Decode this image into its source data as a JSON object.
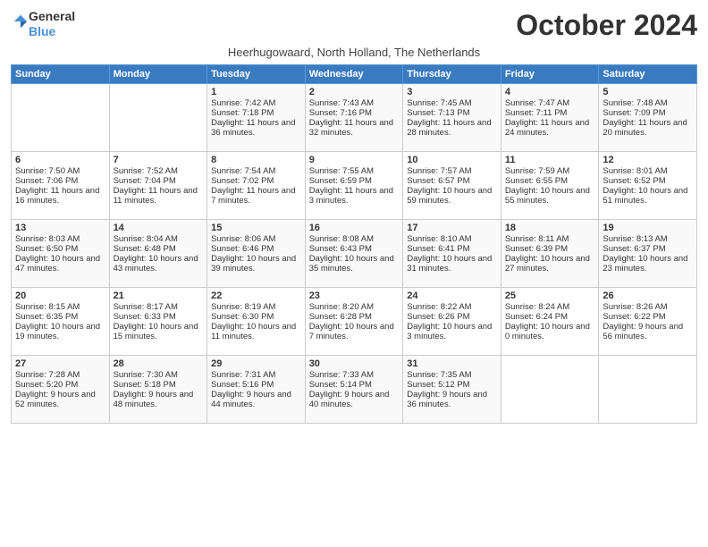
{
  "logo": {
    "line1": "General",
    "line2": "Blue"
  },
  "title": "October 2024",
  "subtitle": "Heerhugowaard, North Holland, The Netherlands",
  "headers": [
    "Sunday",
    "Monday",
    "Tuesday",
    "Wednesday",
    "Thursday",
    "Friday",
    "Saturday"
  ],
  "weeks": [
    [
      {
        "day": "",
        "sunrise": "",
        "sunset": "",
        "daylight": ""
      },
      {
        "day": "",
        "sunrise": "",
        "sunset": "",
        "daylight": ""
      },
      {
        "day": "1",
        "sunrise": "Sunrise: 7:42 AM",
        "sunset": "Sunset: 7:18 PM",
        "daylight": "Daylight: 11 hours and 36 minutes."
      },
      {
        "day": "2",
        "sunrise": "Sunrise: 7:43 AM",
        "sunset": "Sunset: 7:16 PM",
        "daylight": "Daylight: 11 hours and 32 minutes."
      },
      {
        "day": "3",
        "sunrise": "Sunrise: 7:45 AM",
        "sunset": "Sunset: 7:13 PM",
        "daylight": "Daylight: 11 hours and 28 minutes."
      },
      {
        "day": "4",
        "sunrise": "Sunrise: 7:47 AM",
        "sunset": "Sunset: 7:11 PM",
        "daylight": "Daylight: 11 hours and 24 minutes."
      },
      {
        "day": "5",
        "sunrise": "Sunrise: 7:48 AM",
        "sunset": "Sunset: 7:09 PM",
        "daylight": "Daylight: 11 hours and 20 minutes."
      }
    ],
    [
      {
        "day": "6",
        "sunrise": "Sunrise: 7:50 AM",
        "sunset": "Sunset: 7:06 PM",
        "daylight": "Daylight: 11 hours and 16 minutes."
      },
      {
        "day": "7",
        "sunrise": "Sunrise: 7:52 AM",
        "sunset": "Sunset: 7:04 PM",
        "daylight": "Daylight: 11 hours and 11 minutes."
      },
      {
        "day": "8",
        "sunrise": "Sunrise: 7:54 AM",
        "sunset": "Sunset: 7:02 PM",
        "daylight": "Daylight: 11 hours and 7 minutes."
      },
      {
        "day": "9",
        "sunrise": "Sunrise: 7:55 AM",
        "sunset": "Sunset: 6:59 PM",
        "daylight": "Daylight: 11 hours and 3 minutes."
      },
      {
        "day": "10",
        "sunrise": "Sunrise: 7:57 AM",
        "sunset": "Sunset: 6:57 PM",
        "daylight": "Daylight: 10 hours and 59 minutes."
      },
      {
        "day": "11",
        "sunrise": "Sunrise: 7:59 AM",
        "sunset": "Sunset: 6:55 PM",
        "daylight": "Daylight: 10 hours and 55 minutes."
      },
      {
        "day": "12",
        "sunrise": "Sunrise: 8:01 AM",
        "sunset": "Sunset: 6:52 PM",
        "daylight": "Daylight: 10 hours and 51 minutes."
      }
    ],
    [
      {
        "day": "13",
        "sunrise": "Sunrise: 8:03 AM",
        "sunset": "Sunset: 6:50 PM",
        "daylight": "Daylight: 10 hours and 47 minutes."
      },
      {
        "day": "14",
        "sunrise": "Sunrise: 8:04 AM",
        "sunset": "Sunset: 6:48 PM",
        "daylight": "Daylight: 10 hours and 43 minutes."
      },
      {
        "day": "15",
        "sunrise": "Sunrise: 8:06 AM",
        "sunset": "Sunset: 6:46 PM",
        "daylight": "Daylight: 10 hours and 39 minutes."
      },
      {
        "day": "16",
        "sunrise": "Sunrise: 8:08 AM",
        "sunset": "Sunset: 6:43 PM",
        "daylight": "Daylight: 10 hours and 35 minutes."
      },
      {
        "day": "17",
        "sunrise": "Sunrise: 8:10 AM",
        "sunset": "Sunset: 6:41 PM",
        "daylight": "Daylight: 10 hours and 31 minutes."
      },
      {
        "day": "18",
        "sunrise": "Sunrise: 8:11 AM",
        "sunset": "Sunset: 6:39 PM",
        "daylight": "Daylight: 10 hours and 27 minutes."
      },
      {
        "day": "19",
        "sunrise": "Sunrise: 8:13 AM",
        "sunset": "Sunset: 6:37 PM",
        "daylight": "Daylight: 10 hours and 23 minutes."
      }
    ],
    [
      {
        "day": "20",
        "sunrise": "Sunrise: 8:15 AM",
        "sunset": "Sunset: 6:35 PM",
        "daylight": "Daylight: 10 hours and 19 minutes."
      },
      {
        "day": "21",
        "sunrise": "Sunrise: 8:17 AM",
        "sunset": "Sunset: 6:33 PM",
        "daylight": "Daylight: 10 hours and 15 minutes."
      },
      {
        "day": "22",
        "sunrise": "Sunrise: 8:19 AM",
        "sunset": "Sunset: 6:30 PM",
        "daylight": "Daylight: 10 hours and 11 minutes."
      },
      {
        "day": "23",
        "sunrise": "Sunrise: 8:20 AM",
        "sunset": "Sunset: 6:28 PM",
        "daylight": "Daylight: 10 hours and 7 minutes."
      },
      {
        "day": "24",
        "sunrise": "Sunrise: 8:22 AM",
        "sunset": "Sunset: 6:26 PM",
        "daylight": "Daylight: 10 hours and 3 minutes."
      },
      {
        "day": "25",
        "sunrise": "Sunrise: 8:24 AM",
        "sunset": "Sunset: 6:24 PM",
        "daylight": "Daylight: 10 hours and 0 minutes."
      },
      {
        "day": "26",
        "sunrise": "Sunrise: 8:26 AM",
        "sunset": "Sunset: 6:22 PM",
        "daylight": "Daylight: 9 hours and 56 minutes."
      }
    ],
    [
      {
        "day": "27",
        "sunrise": "Sunrise: 7:28 AM",
        "sunset": "Sunset: 5:20 PM",
        "daylight": "Daylight: 9 hours and 52 minutes."
      },
      {
        "day": "28",
        "sunrise": "Sunrise: 7:30 AM",
        "sunset": "Sunset: 5:18 PM",
        "daylight": "Daylight: 9 hours and 48 minutes."
      },
      {
        "day": "29",
        "sunrise": "Sunrise: 7:31 AM",
        "sunset": "Sunset: 5:16 PM",
        "daylight": "Daylight: 9 hours and 44 minutes."
      },
      {
        "day": "30",
        "sunrise": "Sunrise: 7:33 AM",
        "sunset": "Sunset: 5:14 PM",
        "daylight": "Daylight: 9 hours and 40 minutes."
      },
      {
        "day": "31",
        "sunrise": "Sunrise: 7:35 AM",
        "sunset": "Sunset: 5:12 PM",
        "daylight": "Daylight: 9 hours and 36 minutes."
      },
      {
        "day": "",
        "sunrise": "",
        "sunset": "",
        "daylight": ""
      },
      {
        "day": "",
        "sunrise": "",
        "sunset": "",
        "daylight": ""
      }
    ]
  ]
}
